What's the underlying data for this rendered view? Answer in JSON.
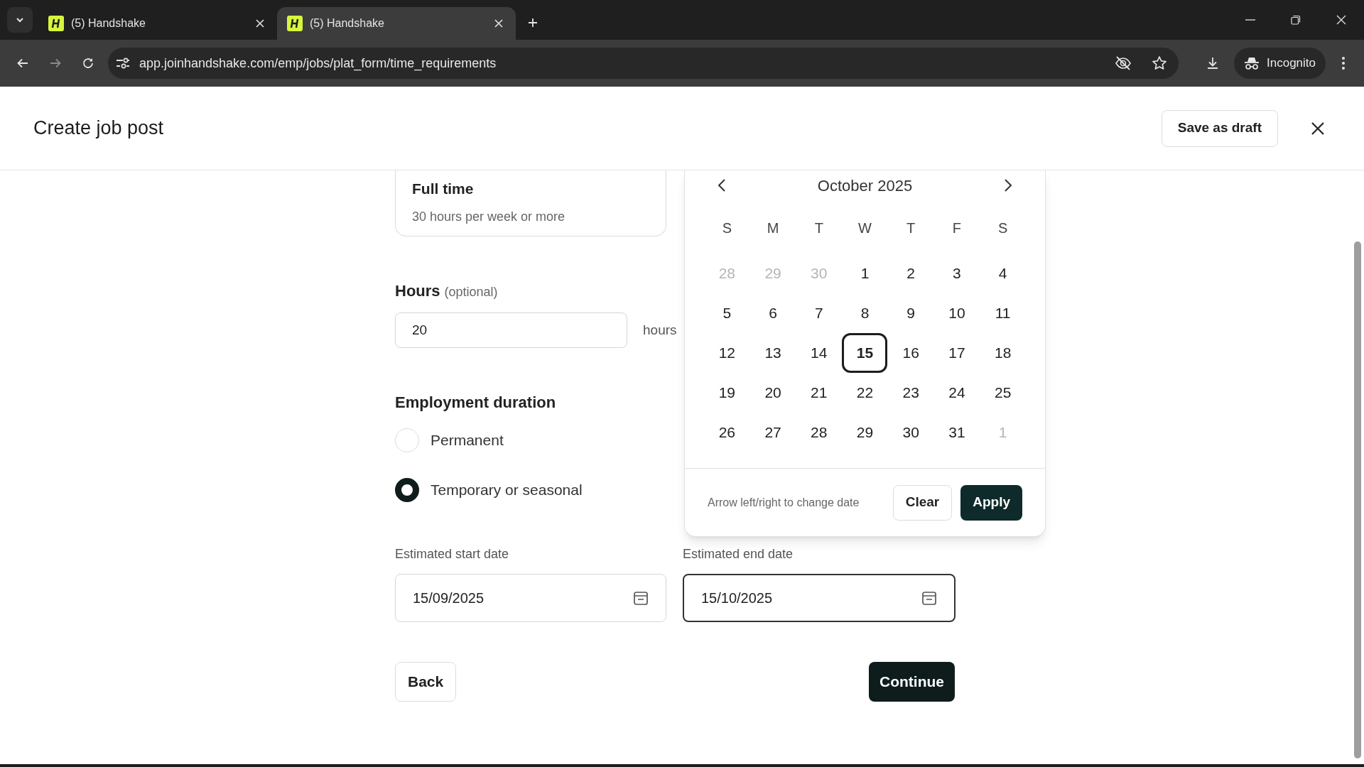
{
  "browser": {
    "tabs": [
      {
        "title": "(5) Handshake",
        "selected": false
      },
      {
        "title": "(5) Handshake",
        "selected": true
      }
    ],
    "address": "app.joinhandshake.com/emp/jobs/plat_form/time_requirements",
    "profile": "Incognito"
  },
  "header": {
    "title": "Create job post",
    "save_button": "Save as draft"
  },
  "job_type_card": {
    "title": "Full time",
    "description": "30 hours per week or more"
  },
  "hours": {
    "label": "Hours",
    "optional": "(optional)",
    "value": "20",
    "unit": "hours"
  },
  "employment_duration": {
    "label": "Employment duration",
    "options": [
      {
        "label": "Permanent",
        "selected": false
      },
      {
        "label": "Temporary or seasonal",
        "selected": true
      }
    ]
  },
  "start_date": {
    "label": "Estimated start date",
    "value": "15/09/2025",
    "focused": false
  },
  "end_date": {
    "label": "Estimated end date",
    "value": "15/10/2025",
    "focused": true
  },
  "calendar": {
    "month": "October 2025",
    "weekdays": [
      "S",
      "M",
      "T",
      "W",
      "T",
      "F",
      "S"
    ],
    "weeks": [
      [
        {
          "day": "28",
          "in_month": false,
          "selected": false
        },
        {
          "day": "29",
          "in_month": false,
          "selected": false
        },
        {
          "day": "30",
          "in_month": false,
          "selected": false
        },
        {
          "day": "1",
          "in_month": true,
          "selected": false
        },
        {
          "day": "2",
          "in_month": true,
          "selected": false
        },
        {
          "day": "3",
          "in_month": true,
          "selected": false
        },
        {
          "day": "4",
          "in_month": true,
          "selected": false
        }
      ],
      [
        {
          "day": "5",
          "in_month": true,
          "selected": false
        },
        {
          "day": "6",
          "in_month": true,
          "selected": false
        },
        {
          "day": "7",
          "in_month": true,
          "selected": false
        },
        {
          "day": "8",
          "in_month": true,
          "selected": false
        },
        {
          "day": "9",
          "in_month": true,
          "selected": false
        },
        {
          "day": "10",
          "in_month": true,
          "selected": false
        },
        {
          "day": "11",
          "in_month": true,
          "selected": false
        }
      ],
      [
        {
          "day": "12",
          "in_month": true,
          "selected": false
        },
        {
          "day": "13",
          "in_month": true,
          "selected": false
        },
        {
          "day": "14",
          "in_month": true,
          "selected": false
        },
        {
          "day": "15",
          "in_month": true,
          "selected": true
        },
        {
          "day": "16",
          "in_month": true,
          "selected": false
        },
        {
          "day": "17",
          "in_month": true,
          "selected": false
        },
        {
          "day": "18",
          "in_month": true,
          "selected": false
        }
      ],
      [
        {
          "day": "19",
          "in_month": true,
          "selected": false
        },
        {
          "day": "20",
          "in_month": true,
          "selected": false
        },
        {
          "day": "21",
          "in_month": true,
          "selected": false
        },
        {
          "day": "22",
          "in_month": true,
          "selected": false
        },
        {
          "day": "23",
          "in_month": true,
          "selected": false
        },
        {
          "day": "24",
          "in_month": true,
          "selected": false
        },
        {
          "day": "25",
          "in_month": true,
          "selected": false
        }
      ],
      [
        {
          "day": "26",
          "in_month": true,
          "selected": false
        },
        {
          "day": "27",
          "in_month": true,
          "selected": false
        },
        {
          "day": "28",
          "in_month": true,
          "selected": false
        },
        {
          "day": "29",
          "in_month": true,
          "selected": false
        },
        {
          "day": "30",
          "in_month": true,
          "selected": false
        },
        {
          "day": "31",
          "in_month": true,
          "selected": false
        },
        {
          "day": "1",
          "in_month": false,
          "selected": false
        }
      ]
    ],
    "hint": "Arrow left/right to change date",
    "clear": "Clear",
    "apply": "Apply"
  },
  "buttons": {
    "back": "Back",
    "continue": "Continue"
  }
}
